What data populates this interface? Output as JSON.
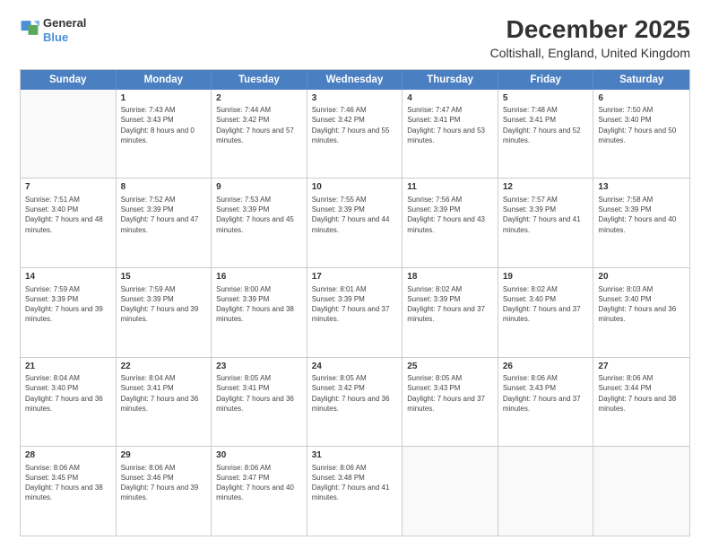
{
  "logo": {
    "general": "General",
    "blue": "Blue"
  },
  "title": "December 2025",
  "subtitle": "Coltishall, England, United Kingdom",
  "days": [
    "Sunday",
    "Monday",
    "Tuesday",
    "Wednesday",
    "Thursday",
    "Friday",
    "Saturday"
  ],
  "weeks": [
    [
      {
        "day": "",
        "empty": true
      },
      {
        "day": "1",
        "rise": "7:43 AM",
        "set": "3:43 PM",
        "hours": "8 hours and 0 minutes."
      },
      {
        "day": "2",
        "rise": "7:44 AM",
        "set": "3:42 PM",
        "hours": "7 hours and 57 minutes."
      },
      {
        "day": "3",
        "rise": "7:46 AM",
        "set": "3:42 PM",
        "hours": "7 hours and 55 minutes."
      },
      {
        "day": "4",
        "rise": "7:47 AM",
        "set": "3:41 PM",
        "hours": "7 hours and 53 minutes."
      },
      {
        "day": "5",
        "rise": "7:48 AM",
        "set": "3:41 PM",
        "hours": "7 hours and 52 minutes."
      },
      {
        "day": "6",
        "rise": "7:50 AM",
        "set": "3:40 PM",
        "hours": "7 hours and 50 minutes."
      }
    ],
    [
      {
        "day": "7",
        "rise": "7:51 AM",
        "set": "3:40 PM",
        "hours": "7 hours and 48 minutes."
      },
      {
        "day": "8",
        "rise": "7:52 AM",
        "set": "3:39 PM",
        "hours": "7 hours and 47 minutes."
      },
      {
        "day": "9",
        "rise": "7:53 AM",
        "set": "3:39 PM",
        "hours": "7 hours and 45 minutes."
      },
      {
        "day": "10",
        "rise": "7:55 AM",
        "set": "3:39 PM",
        "hours": "7 hours and 44 minutes."
      },
      {
        "day": "11",
        "rise": "7:56 AM",
        "set": "3:39 PM",
        "hours": "7 hours and 43 minutes."
      },
      {
        "day": "12",
        "rise": "7:57 AM",
        "set": "3:39 PM",
        "hours": "7 hours and 41 minutes."
      },
      {
        "day": "13",
        "rise": "7:58 AM",
        "set": "3:39 PM",
        "hours": "7 hours and 40 minutes."
      }
    ],
    [
      {
        "day": "14",
        "rise": "7:59 AM",
        "set": "3:39 PM",
        "hours": "7 hours and 39 minutes."
      },
      {
        "day": "15",
        "rise": "7:59 AM",
        "set": "3:39 PM",
        "hours": "7 hours and 39 minutes."
      },
      {
        "day": "16",
        "rise": "8:00 AM",
        "set": "3:39 PM",
        "hours": "7 hours and 38 minutes."
      },
      {
        "day": "17",
        "rise": "8:01 AM",
        "set": "3:39 PM",
        "hours": "7 hours and 37 minutes."
      },
      {
        "day": "18",
        "rise": "8:02 AM",
        "set": "3:39 PM",
        "hours": "7 hours and 37 minutes."
      },
      {
        "day": "19",
        "rise": "8:02 AM",
        "set": "3:40 PM",
        "hours": "7 hours and 37 minutes."
      },
      {
        "day": "20",
        "rise": "8:03 AM",
        "set": "3:40 PM",
        "hours": "7 hours and 36 minutes."
      }
    ],
    [
      {
        "day": "21",
        "rise": "8:04 AM",
        "set": "3:40 PM",
        "hours": "7 hours and 36 minutes."
      },
      {
        "day": "22",
        "rise": "8:04 AM",
        "set": "3:41 PM",
        "hours": "7 hours and 36 minutes."
      },
      {
        "day": "23",
        "rise": "8:05 AM",
        "set": "3:41 PM",
        "hours": "7 hours and 36 minutes."
      },
      {
        "day": "24",
        "rise": "8:05 AM",
        "set": "3:42 PM",
        "hours": "7 hours and 36 minutes."
      },
      {
        "day": "25",
        "rise": "8:05 AM",
        "set": "3:43 PM",
        "hours": "7 hours and 37 minutes."
      },
      {
        "day": "26",
        "rise": "8:06 AM",
        "set": "3:43 PM",
        "hours": "7 hours and 37 minutes."
      },
      {
        "day": "27",
        "rise": "8:06 AM",
        "set": "3:44 PM",
        "hours": "7 hours and 38 minutes."
      }
    ],
    [
      {
        "day": "28",
        "rise": "8:06 AM",
        "set": "3:45 PM",
        "hours": "7 hours and 38 minutes."
      },
      {
        "day": "29",
        "rise": "8:06 AM",
        "set": "3:46 PM",
        "hours": "7 hours and 39 minutes."
      },
      {
        "day": "30",
        "rise": "8:06 AM",
        "set": "3:47 PM",
        "hours": "7 hours and 40 minutes."
      },
      {
        "day": "31",
        "rise": "8:06 AM",
        "set": "3:48 PM",
        "hours": "7 hours and 41 minutes."
      },
      {
        "day": "",
        "empty": true
      },
      {
        "day": "",
        "empty": true
      },
      {
        "day": "",
        "empty": true
      }
    ]
  ]
}
